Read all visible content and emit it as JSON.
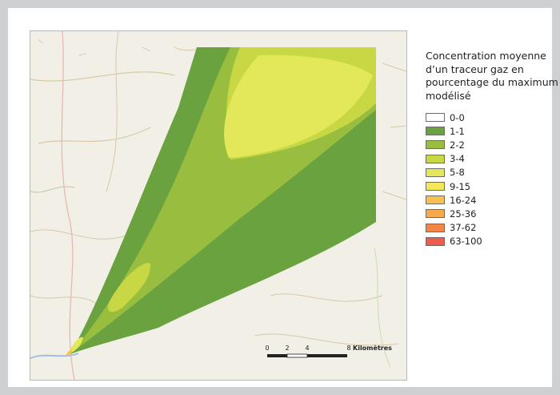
{
  "legend": {
    "title_lines": [
      "Concentration moyenne",
      "d’un traceur gaz en",
      "pourcentage du maximum",
      "modélisé"
    ],
    "items": [
      {
        "label": "0-0",
        "color": "#ffffff"
      },
      {
        "label": "1-1",
        "color": "#6aa23f"
      },
      {
        "label": "2-2",
        "color": "#98bd3f"
      },
      {
        "label": "3-4",
        "color": "#c8d845"
      },
      {
        "label": "5-8",
        "color": "#e2e85a"
      },
      {
        "label": "9-15",
        "color": "#f3e85a"
      },
      {
        "label": "16-24",
        "color": "#f6c24f"
      },
      {
        "label": "25-36",
        "color": "#f7a94e"
      },
      {
        "label": "37-62",
        "color": "#f58545"
      },
      {
        "label": "63-100",
        "color": "#ee5a4c"
      }
    ]
  },
  "scale_bar": {
    "ticks": [
      "0",
      "2",
      "4",
      "8"
    ],
    "unit": "Kilomètres"
  },
  "colors": {
    "map_background": "#f1efe6",
    "frame_background": "#cfd0d2"
  }
}
